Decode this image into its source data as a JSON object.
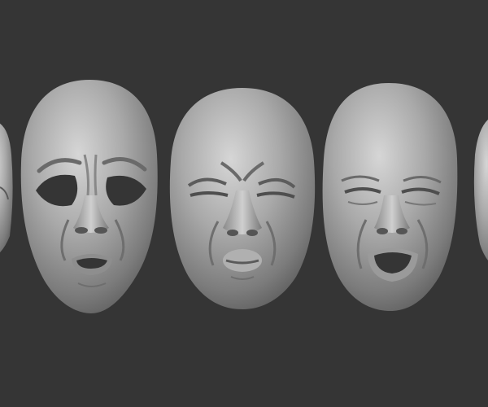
{
  "scene": {
    "background_color": "#353535",
    "clay_color": "#9a9a9a",
    "clay_highlight": "#d6d6d6",
    "clay_shadow": "#4a4a4a",
    "masks": [
      {
        "expression": "partial-left-edge"
      },
      {
        "expression": "worried"
      },
      {
        "expression": "eyes-squeezed-pursed-lips"
      },
      {
        "expression": "eyes-closed-mouth-open"
      },
      {
        "expression": "partial-right-edge"
      }
    ]
  }
}
